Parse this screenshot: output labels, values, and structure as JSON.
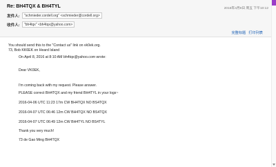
{
  "header": {
    "subject": "Re: BH4TQX & BH4TYL",
    "datetime": "2016年4月8日 周五 下午10:12",
    "from_label": "发件人:",
    "from_value": "\"schmieder.cordell.org\" <schmieder@cordell.org>",
    "to_label": "收件人:",
    "to_value": "\"bh4tqx\" <bh4tqx@yahoo.com>",
    "actions": [
      "完整标题",
      "打印列表"
    ]
  },
  "body": {
    "lines": [
      "You should send this to the \"Contact us\" link on vk0ek.org.",
      "73, Bob KK6EK on Heard Island"
    ],
    "quote": {
      "intro": "On April 8, 2016 at 8:10 AM bh4tqx@yahoo.com wrote:",
      "greeting": "Dear VK0EK,",
      "para1": "I'm coming back with my request. Please answer.",
      "para2": "PLEASE correct BH4TQX and my friend BH4TYL in your logs~",
      "logs": [
        "2016-04-06 UTC 11:23 17m CW BH4TQX NO BS4TQX",
        "2016-04-07 UTC 06:46 12m CW BH4TQX NO BS4TQX",
        "2016-04-07 UTC 06:49 12m CW BH4TYL NO BS4TYL"
      ],
      "thanks": "Thank you very much!",
      "signature": "73 de Gao Ming BH4TQX"
    }
  },
  "colors": {
    "accent": "#1a5fb4",
    "scroll_thumb": "#9b3cc8",
    "header_bg": "#f6f6f6"
  }
}
